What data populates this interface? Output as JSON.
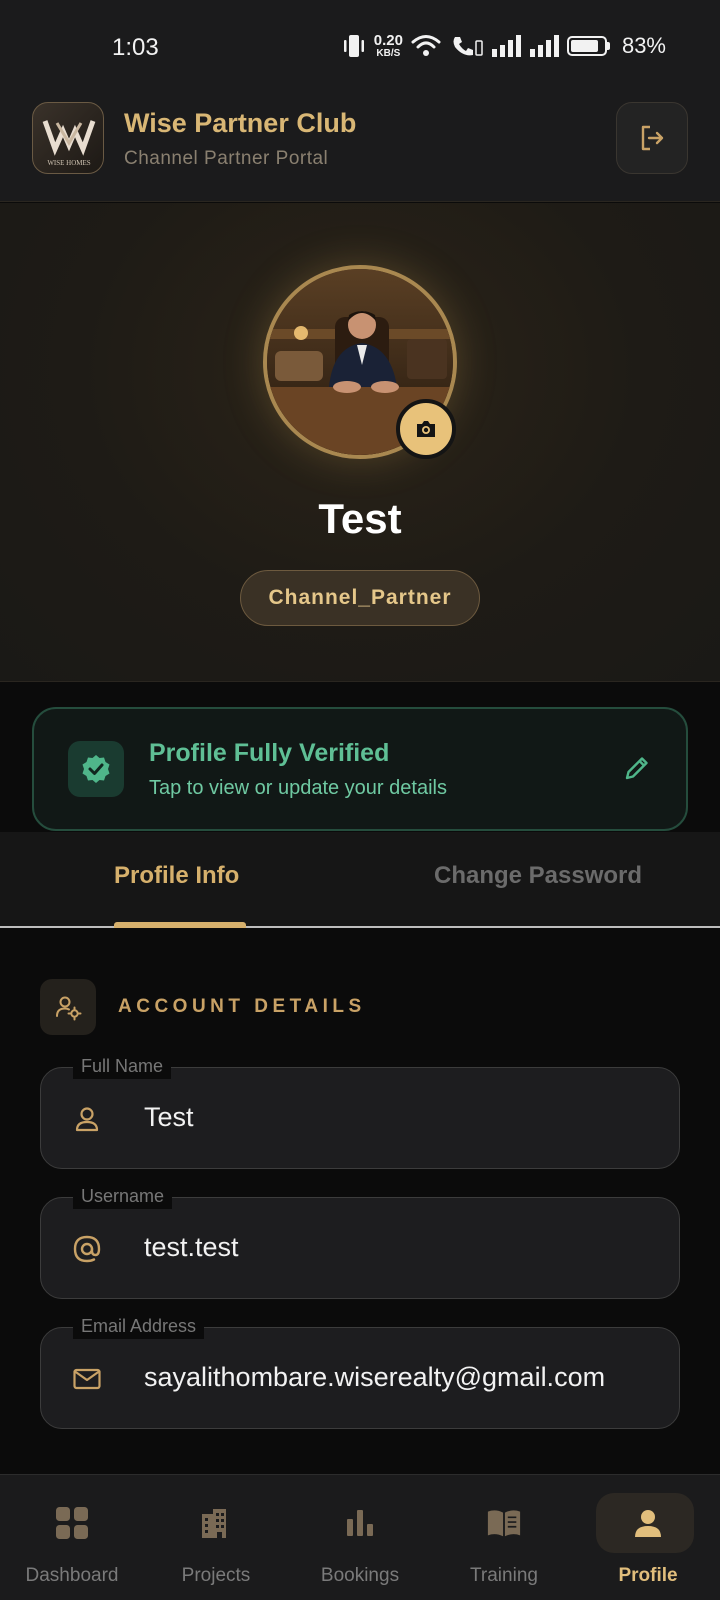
{
  "status_bar": {
    "time": "1:03",
    "net_speed_top": "0.20",
    "net_speed_unit": "KB/S",
    "battery_percent": "83%",
    "battery_level": 0.83,
    "icons": [
      "vibrate-icon",
      "wifi-icon",
      "wifi-call-icon",
      "signal-icon",
      "signal-icon",
      "battery-icon"
    ]
  },
  "header": {
    "title": "Wise Partner Club",
    "subtitle": "Channel Partner Portal",
    "logo_text": "WISE HOMES",
    "logout_icon": "logout-icon"
  },
  "profile": {
    "name": "Test",
    "role": "Channel_Partner",
    "camera_icon": "camera-icon"
  },
  "verification": {
    "title": "Profile Fully Verified",
    "subtitle": "Tap to view or update your details",
    "icon": "verified-badge-icon",
    "edit_icon": "pencil-icon"
  },
  "tabs": [
    {
      "label": "Profile Info",
      "active": true
    },
    {
      "label": "Change Password",
      "active": false
    }
  ],
  "account_details": {
    "title": "ACCOUNT DETAILS",
    "icon": "user-gear-icon",
    "fields": [
      {
        "label": "Full Name",
        "value": "Test",
        "icon": "user-icon"
      },
      {
        "label": "Username",
        "value": "test.test",
        "icon": "at-icon"
      },
      {
        "label": "Email Address",
        "value": "sayalithombare.wiserealty@gmail.com",
        "icon": "mail-icon"
      }
    ]
  },
  "bottom_nav": [
    {
      "label": "Dashboard",
      "icon": "grid-icon",
      "active": false
    },
    {
      "label": "Projects",
      "icon": "building-icon",
      "active": false
    },
    {
      "label": "Bookings",
      "icon": "bar-chart-icon",
      "active": false
    },
    {
      "label": "Training",
      "icon": "book-icon",
      "active": false
    },
    {
      "label": "Profile",
      "icon": "person-icon",
      "active": true
    }
  ],
  "colors": {
    "accent_gold": "#d6b06c",
    "verified_green": "#5fbf95",
    "background": "#0b0b0b"
  }
}
